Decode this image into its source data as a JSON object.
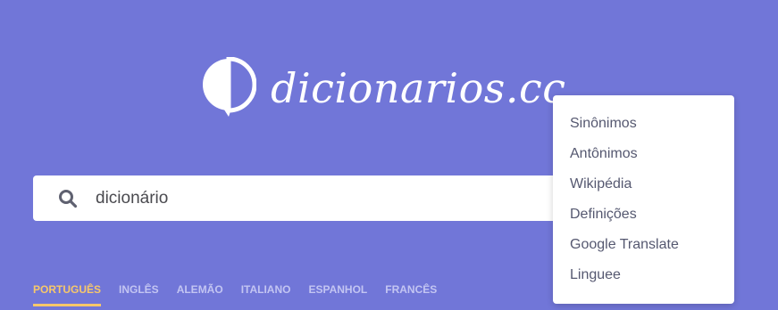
{
  "logo": {
    "text": "dicionarios.cc",
    "icon": "speech-bubble-half-icon"
  },
  "search": {
    "value": "dicionário",
    "icon": "search-icon"
  },
  "languages": [
    {
      "label": "PORTUGUÊS",
      "active": true
    },
    {
      "label": "INGLÊS",
      "active": false
    },
    {
      "label": "ALEMÃO",
      "active": false
    },
    {
      "label": "ITALIANO",
      "active": false
    },
    {
      "label": "ESPANHOL",
      "active": false
    },
    {
      "label": "FRANCÊS",
      "active": false
    }
  ],
  "dropdown": {
    "items": [
      {
        "label": "Sinônimos"
      },
      {
        "label": "Antônimos"
      },
      {
        "label": "Wikipédia"
      },
      {
        "label": "Definições"
      },
      {
        "label": "Google Translate"
      },
      {
        "label": "Linguee"
      }
    ]
  },
  "colors": {
    "background": "#7176d8",
    "active_tab": "#f7c86a",
    "inactive_tab": "#c3c5f2"
  }
}
